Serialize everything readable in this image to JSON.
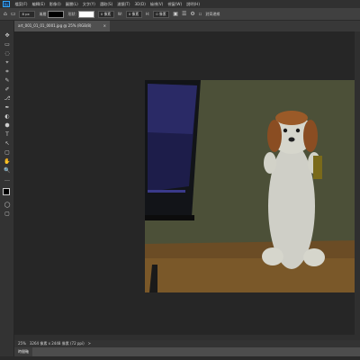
{
  "app": {
    "logo_text": "Ps"
  },
  "menus": [
    "檔案(F)",
    "編輯(E)",
    "影像(I)",
    "圖層(L)",
    "文字(Y)",
    "選取(S)",
    "濾鏡(T)",
    "3D(D)",
    "檢視(V)",
    "視窗(W)",
    "說明(H)"
  ],
  "options": {
    "size_label": "8 px",
    "mode_label": "漸層",
    "shape_label": "形狀:",
    "opacity_label": "0 像素",
    "weight_label": "W:",
    "w_value": "0 像素",
    "h_label": "H:",
    "h_value": "0 像素",
    "align_label": "對齊邊緣"
  },
  "document": {
    "tab_title": "art_001_01_01_0001.jpg @ 25% (RGB/8)",
    "close_symbol": "×"
  },
  "status": {
    "zoom": "25%",
    "doc_info": "3264 像素 x 2448 像素 (72 ppi)",
    "arrow": ">"
  },
  "panel": {
    "tab_label": "時間軸"
  },
  "tools": [
    "✥",
    "▭",
    "◌",
    "⌖",
    "⌗",
    "✎",
    "✐",
    "⎇",
    "✒",
    "◐",
    "⬢",
    "T",
    "↖",
    "▢",
    "✋",
    "🔍",
    "…"
  ]
}
